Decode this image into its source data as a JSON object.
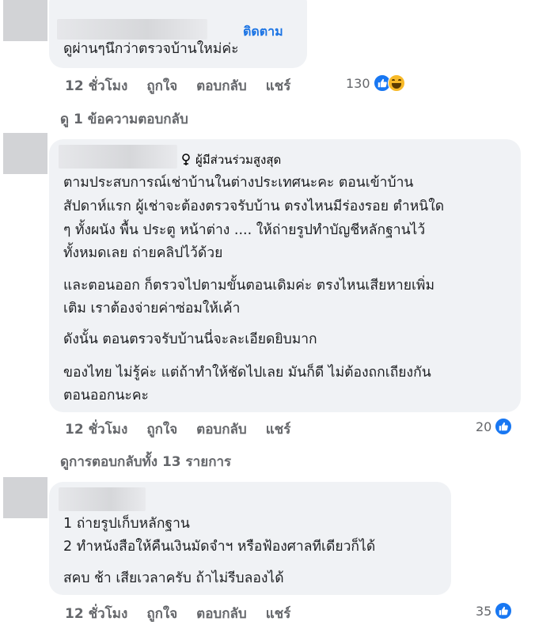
{
  "comments": [
    {
      "follow_label": "ติดตาม",
      "lines": [
        "ดูผ่านๆนึกว่าตรวจบ้านใหม่ค่ะ"
      ],
      "time": "12 ชั่วโมง",
      "like_label": "ถูกใจ",
      "reply_label": "ตอบกลับ",
      "share_label": "แชร์",
      "reaction_count": "130",
      "reaction_icons": [
        "like-icon",
        "haha-icon"
      ],
      "view_replies": "ดู 1 ข้อความตอบกลับ"
    },
    {
      "badge_label": "ผู้มีส่วนร่วมสูงสุด",
      "badge_icon": "top-contributor-icon",
      "lines": [
        "ตามประสบการณ์เช่าบ้านในต่างประเทศนะคะ ตอนเข้าบ้าน",
        "สัปดาห์แรก ผู้เช่าจะต้องตรวจรับบ้าน ตรงไหนมีร่องรอย ตำหนิใด",
        "ๆ ทั้งผนัง พื้น ประตู หน้าต่าง .... ให้ถ่ายรูปทำบัญชีหลักฐานไว้",
        "ทั้งหมดเลย ถ่ายคลิปไว้ด้วย",
        "และตอนออก ก็ตรวจไปตามขั้นตอนเดิมค่ะ ตรงไหนเสียหายเพิ่ม",
        "เติม เราต้องจ่ายค่าซ่อมให้เค้า",
        "ดังนั้น ตอนตรวจรับบ้านนี่จะละเอียดยิบมาก",
        "ของไทย ไม่รู้ค่ะ แต่ถ้าทำให้ชัดไปเลย มันก็ดี ไม่ต้องถกเถียงกัน",
        "ตอนออกนะคะ"
      ],
      "time": "12 ชั่วโมง",
      "like_label": "ถูกใจ",
      "reply_label": "ตอบกลับ",
      "share_label": "แชร์",
      "reaction_count": "20",
      "reaction_icons": [
        "like-icon"
      ],
      "view_replies": "ดูการตอบกลับทั้ง 13 รายการ"
    },
    {
      "lines": [
        "1 ถ่ายรูปเก็บหลักฐาน",
        "2 ทำหนังสือให้คืนเงินมัดจำฯ หรือฟ้องศาลทีเดียวก็ได้",
        "สคบ ช้า เสียเวลาครับ ถ้าไม่รีบลองได้"
      ],
      "time": "12 ชั่วโมง",
      "like_label": "ถูกใจ",
      "reply_label": "ตอบกลับ",
      "share_label": "แชร์",
      "reaction_count": "35",
      "reaction_icons": [
        "like-icon"
      ]
    }
  ],
  "colors": {
    "bubble": "#f0f2f5",
    "secondary_text": "#65676b",
    "link": "#1b74e4",
    "like": "#1877f2"
  }
}
